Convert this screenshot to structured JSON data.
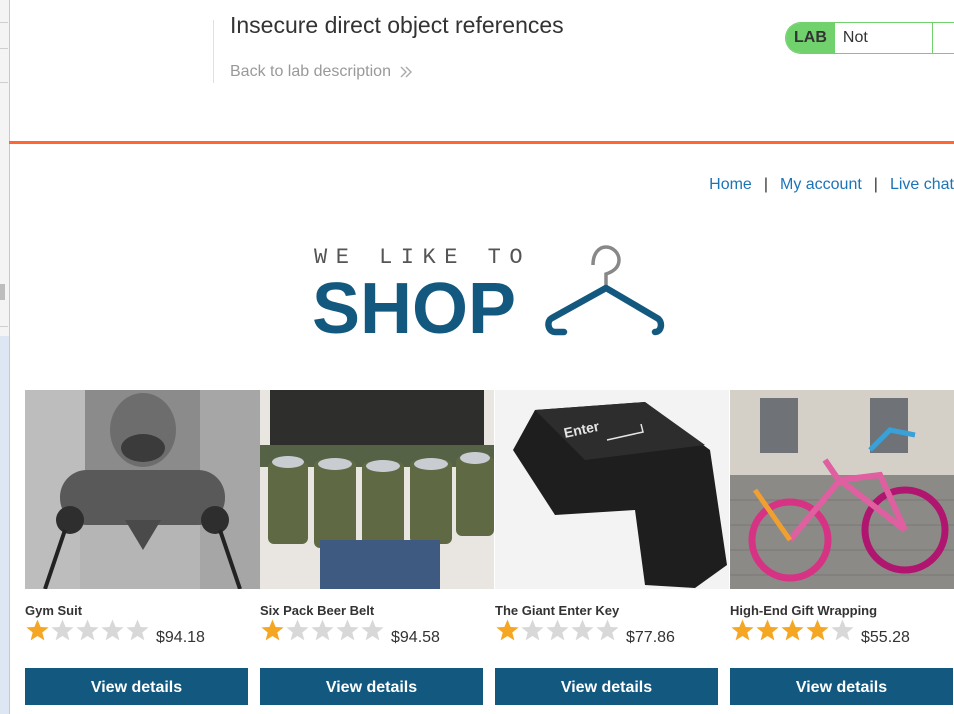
{
  "header": {
    "lab_title": "Insecure direct object references",
    "back_link": "Back to lab description",
    "lab_badge": "LAB",
    "status": "Not solved"
  },
  "nav": {
    "home": "Home",
    "separator": "|",
    "my_account": "My account",
    "live_chat": "Live chat"
  },
  "logo": {
    "line1": "WE LIKE TO",
    "line2": "SHOP"
  },
  "products": [
    {
      "name": "Gym Suit",
      "rating": 1,
      "max_rating": 5,
      "price": "$94.18",
      "button": "View details",
      "image": "gym-suit-image"
    },
    {
      "name": "Six Pack Beer Belt",
      "rating": 1,
      "max_rating": 5,
      "price": "$94.58",
      "button": "View details",
      "image": "beer-belt-image"
    },
    {
      "name": "The Giant Enter Key",
      "rating": 1,
      "max_rating": 5,
      "price": "$77.86",
      "button": "View details",
      "image": "enter-key-image"
    },
    {
      "name": "High-End Gift Wrapping",
      "rating": 4,
      "max_rating": 5,
      "price": "$55.28",
      "button": "View details",
      "image": "gift-wrapping-image"
    }
  ],
  "colors": {
    "accent_orange": "#ff6633",
    "button_blue": "#13597f",
    "link_blue": "#1b74b8",
    "lab_green": "#70d16d",
    "star_filled": "#f5a623",
    "star_empty": "#d8d8d8"
  }
}
